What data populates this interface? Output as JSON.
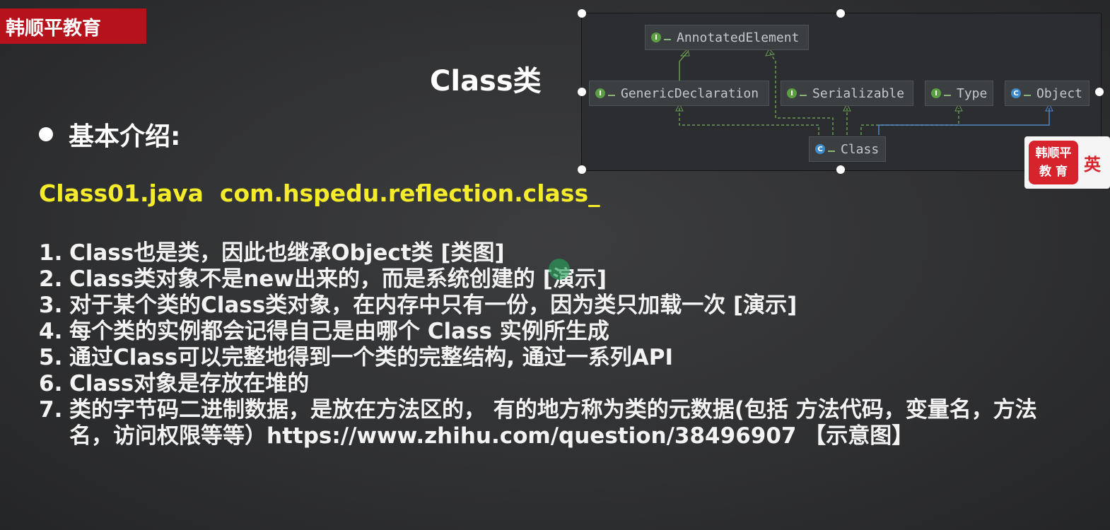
{
  "brand": {
    "label": "韩顺平教育"
  },
  "slide": {
    "title": "Class类",
    "heading": "基本介绍:",
    "source_line": "Class01.java  com.hspedu.reflection.class_",
    "points": [
      {
        "num": "1.",
        "text": "Class也是类，因此也继承Object类 [类图]"
      },
      {
        "num": "2.",
        "text": "Class类对象不是new出来的，而是系统创建的 [演示]"
      },
      {
        "num": "3.",
        "text": "对于某个类的Class类对象，在内存中只有一份，因为类只加载一次 [演示]"
      },
      {
        "num": "4.",
        "text": "每个类的实例都会记得自己是由哪个 Class 实例所生成"
      },
      {
        "num": "5.",
        "text": "通过Class可以完整地得到一个类的完整结构, 通过一系列API"
      },
      {
        "num": "6.",
        "text": "Class对象是存放在堆的"
      },
      {
        "num": "7.",
        "text": "类的字节码二进制数据，是放在方法区的， 有的地方称为类的元数据(包括 方法代码，变量名，方法名，访问权限等等）https://www.zhihu.com/question/38496907 【示意图】"
      }
    ]
  },
  "uml": {
    "nodes": {
      "annotated": {
        "label": "AnnotatedElement",
        "kind": "interface"
      },
      "generic": {
        "label": "GenericDeclaration",
        "kind": "interface"
      },
      "serializable": {
        "label": "Serializable",
        "kind": "interface"
      },
      "type": {
        "label": "Type",
        "kind": "interface"
      },
      "object": {
        "label": "Object",
        "kind": "class"
      },
      "class": {
        "label": "Class",
        "kind": "class"
      }
    },
    "colors": {
      "implements_edge": "#6a9955",
      "extends_edge": "#4f86c6"
    }
  },
  "logo_card": {
    "line1": "韩顺平",
    "line2": "教 育",
    "lang": "英"
  }
}
